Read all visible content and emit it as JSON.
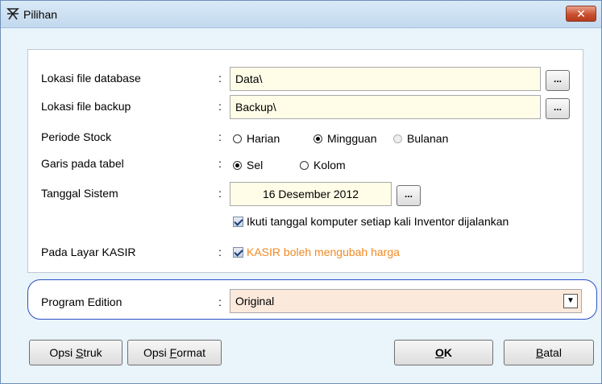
{
  "window": {
    "title": "Pilihan",
    "close_label": "✕"
  },
  "fields": {
    "db_location": {
      "label": "Lokasi file database",
      "value": "Data\\",
      "browse_label": "..."
    },
    "backup_location": {
      "label": "Lokasi file backup",
      "value": "Backup\\",
      "browse_label": "..."
    },
    "stock_period": {
      "label": "Periode Stock",
      "options": [
        "Harian",
        "Mingguan",
        "Bulanan"
      ],
      "selected": "Mingguan"
    },
    "table_lines": {
      "label": "Garis pada tabel",
      "options": [
        "Sel",
        "Kolom"
      ],
      "selected": "Sel"
    },
    "system_date": {
      "label": "Tanggal Sistem",
      "value": "16 Desember 2012",
      "browse_label": "...",
      "follow_computer_label": "Ikuti tanggal komputer setiap kali Inventor dijalankan",
      "follow_computer_checked": true
    },
    "kasir_screen": {
      "label": "Pada Layar KASIR",
      "checkbox_label": "KASIR boleh mengubah harga",
      "checked": true,
      "checkbox_color": "#f08a24"
    },
    "program_edition": {
      "label": "Program Edition",
      "value": "Original"
    }
  },
  "colon": ":",
  "buttons": {
    "opsi_struk": {
      "pre": "Opsi ",
      "accel": "S",
      "post": "truk"
    },
    "opsi_format": {
      "pre": "Opsi ",
      "accel": "F",
      "post": "ormat"
    },
    "ok": {
      "pre": "",
      "accel": "O",
      "post": "K"
    },
    "batal": {
      "pre": "",
      "accel": "B",
      "post": "atal"
    }
  },
  "colors": {
    "accent_border": "#2b4fc4",
    "input_bg": "#fffde8",
    "select_bg": "#fbe9dc"
  }
}
